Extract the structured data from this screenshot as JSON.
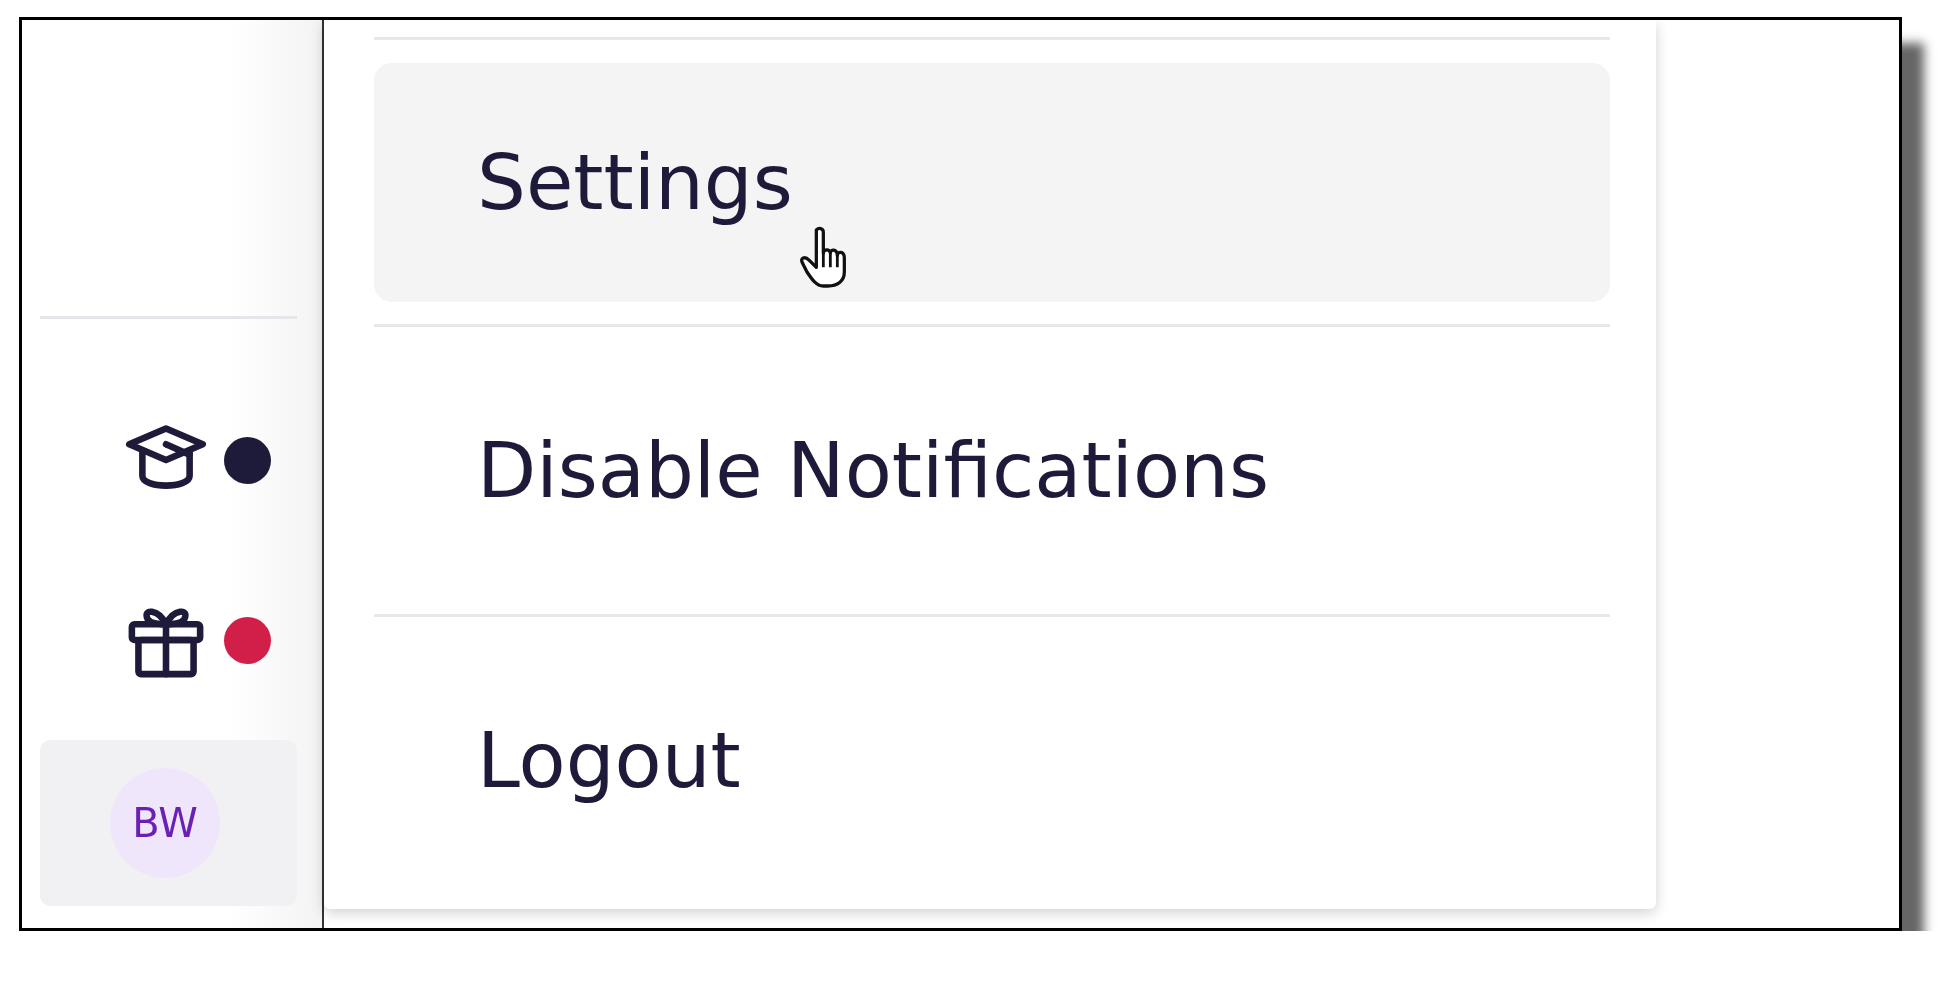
{
  "sidebar": {
    "icons": [
      {
        "kind": "cap",
        "color": "#1e1b3a"
      },
      {
        "kind": "gift",
        "color": "#d21f4a"
      }
    ],
    "avatar": {
      "initials": "BW",
      "selected": true
    }
  },
  "menu": {
    "items": [
      {
        "label": "Settings",
        "highlighted": true
      },
      {
        "label": "Disable Notifications",
        "highlighted": false
      },
      {
        "label": "Logout",
        "highlighted": false
      }
    ]
  }
}
